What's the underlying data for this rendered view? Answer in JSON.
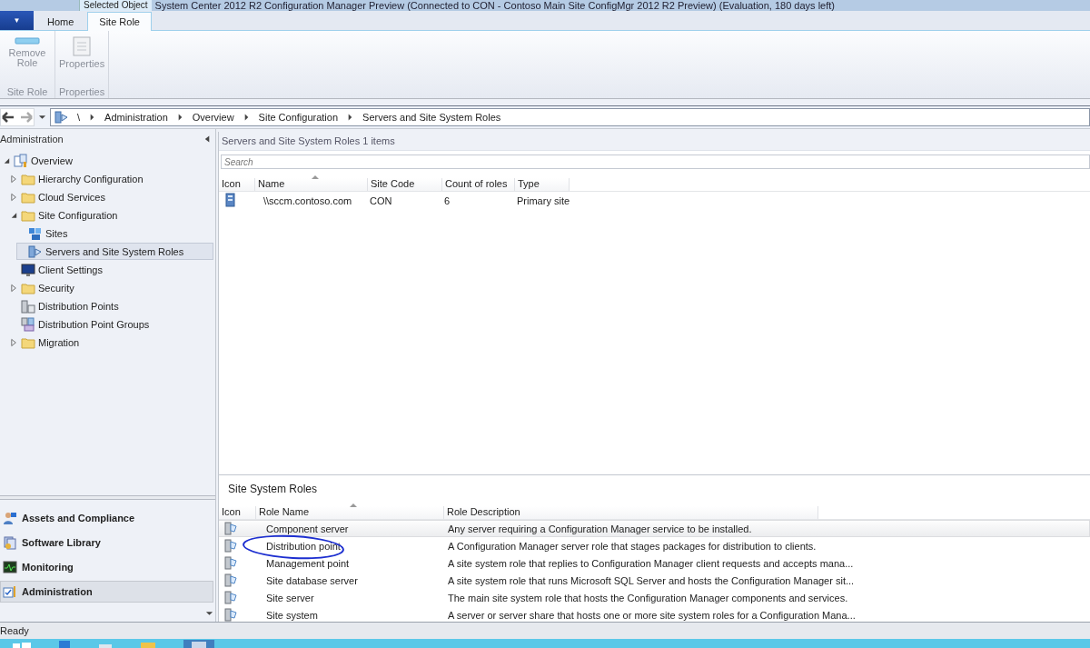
{
  "window": {
    "title": "System Center 2012 R2 Configuration Manager Preview (Connected to CON - Contoso Main Site ConfigMgr 2012 R2 Preview) (Evaluation, 180 days left)"
  },
  "app_menu": {
    "symbol": "▼"
  },
  "context_tab_group": {
    "label": "Selected Object"
  },
  "tabs": [
    {
      "label": "Home",
      "selected": false
    },
    {
      "label": "Site Role",
      "selected": true
    }
  ],
  "ribbon_groups": [
    {
      "label": "Site Role",
      "buttons": [
        {
          "label": "Remove Role",
          "kind": "remove",
          "disabled": true
        }
      ]
    },
    {
      "label": "Properties",
      "buttons": [
        {
          "label": "Properties",
          "kind": "properties",
          "disabled": true
        }
      ]
    }
  ],
  "breadcrumb": [
    "\\",
    "Administration",
    "Overview",
    "Site Configuration",
    "Servers and Site System Roles"
  ],
  "navigation_pane": {
    "title": "Administration",
    "tree": [
      {
        "label": "Overview",
        "kind": "overview",
        "expanded": true,
        "selected": false,
        "children": [
          {
            "label": "Hierarchy Configuration",
            "kind": "folder",
            "expanded": false,
            "selected": false
          },
          {
            "label": "Cloud Services",
            "kind": "folder",
            "expanded": false,
            "selected": false
          },
          {
            "label": "Site Configuration",
            "kind": "folder",
            "expanded": true,
            "selected": false,
            "children": [
              {
                "label": "Sites",
                "kind": "sites",
                "selected": false
              },
              {
                "label": "Servers and Site System Roles",
                "kind": "servers",
                "selected": true
              }
            ]
          },
          {
            "label": "Client Settings",
            "kind": "monitor",
            "selected": false
          },
          {
            "label": "Security",
            "kind": "folder",
            "expanded": false,
            "selected": false
          },
          {
            "label": "Distribution Points",
            "kind": "server",
            "selected": false
          },
          {
            "label": "Distribution Point Groups",
            "kind": "group",
            "selected": false
          },
          {
            "label": "Migration",
            "kind": "folder",
            "expanded": false,
            "selected": false
          }
        ]
      }
    ],
    "workspaces": [
      {
        "label": "Assets and Compliance",
        "kind": "assets",
        "selected": false
      },
      {
        "label": "Software Library",
        "kind": "library",
        "selected": false
      },
      {
        "label": "Monitoring",
        "kind": "monitoring",
        "selected": false
      },
      {
        "label": "Administration",
        "kind": "admin",
        "selected": true
      }
    ]
  },
  "servers_list": {
    "title": "Servers and Site System Roles",
    "count": "1 items",
    "search": {
      "placeholder": "Search"
    },
    "columns": [
      "Icon",
      "Name",
      "Site Code",
      "Count of roles",
      "Type"
    ],
    "rows": [
      {
        "name": "\\\\sccm.contoso.com",
        "site_code": "CON",
        "count": "6",
        "type": "Primary site",
        "selected": false
      }
    ]
  },
  "roles_panel": {
    "title": "Site System Roles",
    "columns": [
      "Icon",
      "Role Name",
      "Role Description"
    ],
    "rows": [
      {
        "name": "Component server",
        "description": "Any server requiring a Configuration Manager service to be installed.",
        "selected": true,
        "circled": false
      },
      {
        "name": "Distribution point",
        "description": "A Configuration Manager server role that stages packages for distribution to clients.",
        "selected": false,
        "circled": true
      },
      {
        "name": "Management point",
        "description": "A site system role that replies to Configuration Manager client requests and accepts mana...",
        "selected": false,
        "circled": false
      },
      {
        "name": "Site database server",
        "description": "A site system role that runs Microsoft SQL Server and hosts the Configuration Manager sit...",
        "selected": false,
        "circled": false
      },
      {
        "name": "Site server",
        "description": "The main site system role that hosts the Configuration Manager components and services.",
        "selected": false,
        "circled": false
      },
      {
        "name": "Site system",
        "description": "A server or server share that hosts one or more site system roles for a Configuration Mana...",
        "selected": false,
        "circled": false
      }
    ]
  },
  "status_bar": {
    "text": "Ready"
  }
}
